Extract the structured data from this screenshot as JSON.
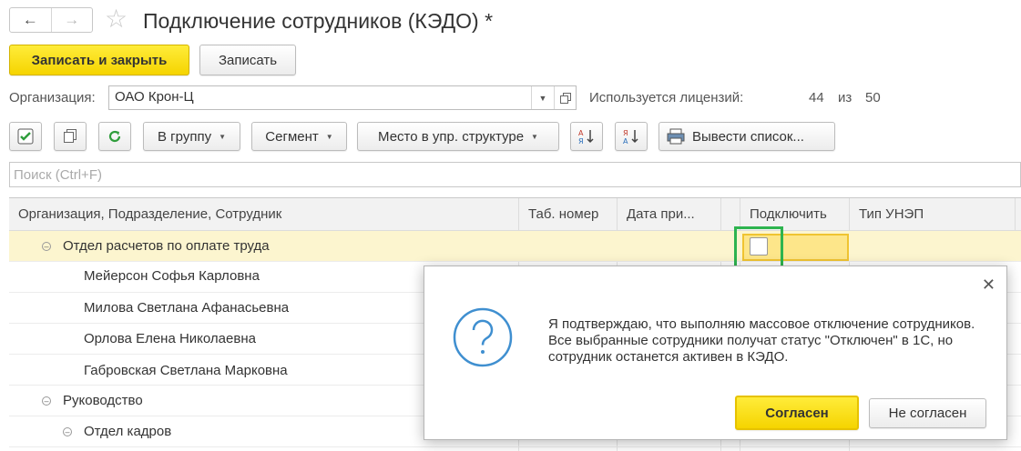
{
  "window": {
    "title": "Подключение сотрудников (КЭДО) *",
    "back_icon": "←",
    "forward_icon": "→",
    "star_icon": "☆"
  },
  "commands": {
    "save_and_close": "Записать и закрыть",
    "save": "Записать"
  },
  "organization": {
    "label": "Организация:",
    "value": "ОАО Крон-Ц"
  },
  "licenses": {
    "label": "Используется лицензий:",
    "used": "44",
    "of": "из",
    "total": "50"
  },
  "toolbar": {
    "to_group": "В группу",
    "segment": "Сегмент",
    "place": "Место в упр. структуре",
    "export": "Вывести список..."
  },
  "search": {
    "placeholder": "Поиск (Ctrl+F)"
  },
  "table": {
    "columns": [
      "Организация, Подразделение, Сотрудник",
      "Таб. номер",
      "Дата при...",
      "Подключить",
      "Тип УНЭП"
    ],
    "rows": [
      "Отдел расчетов по оплате труда",
      "Мейерсон Софья Карловна",
      "Милова Светлана Афанасьевна",
      "Орлова Елена Николаевна",
      "Габровская Светлана Марковна",
      "Руководство",
      "Отдел кадров"
    ]
  },
  "dialog": {
    "message": "Я подтверждаю, что выполняю массовое отключение сотрудников. Все выбранные сотрудники получат статус \"Отключен\" в 1С, но сотрудник останется активен в КЭДО.",
    "agree": "Согласен",
    "disagree": "Не согласен",
    "close_icon": "✕"
  },
  "colors": {
    "accent_yellow": "#f5d400",
    "selection_row": "#fcf5cf",
    "highlight_frame": "#2eb44f",
    "question_icon": "#3f8fd0"
  }
}
